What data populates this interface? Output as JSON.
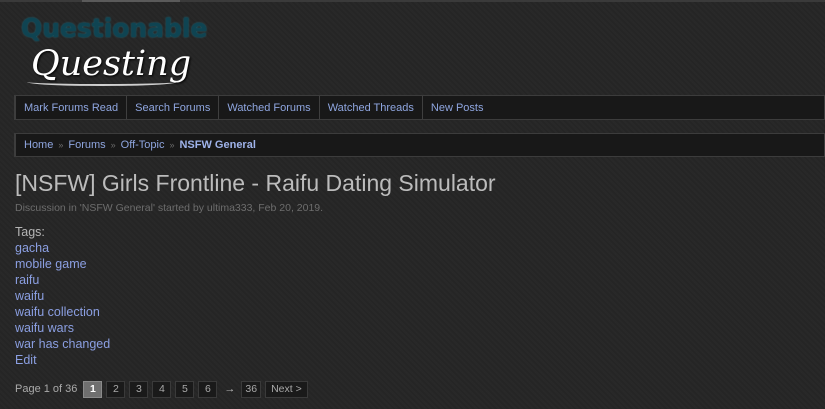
{
  "logo": {
    "line1": "Questionable",
    "line2": "Questing"
  },
  "nav": {
    "items": [
      "Mark Forums Read",
      "Search Forums",
      "Watched Forums",
      "Watched Threads",
      "New Posts"
    ]
  },
  "breadcrumb": {
    "items": [
      "Home",
      "Forums",
      "Off-Topic"
    ],
    "separator": "»",
    "current": "NSFW General"
  },
  "thread": {
    "title": "[NSFW] Girls Frontline - Raifu Dating Simulator",
    "meta": "Discussion in 'NSFW General' started by ultima333, Feb 20, 2019."
  },
  "tags": {
    "label": "Tags:",
    "items": [
      "gacha",
      "mobile game",
      "raifu",
      "waifu",
      "waifu collection",
      "waifu wars",
      "war has changed"
    ],
    "edit": "Edit"
  },
  "pagination": {
    "info": "Page 1 of 36",
    "pages": [
      "1",
      "2",
      "3",
      "4",
      "5",
      "6"
    ],
    "current": "1",
    "gap": "→",
    "last": "36",
    "next": "Next >"
  }
}
